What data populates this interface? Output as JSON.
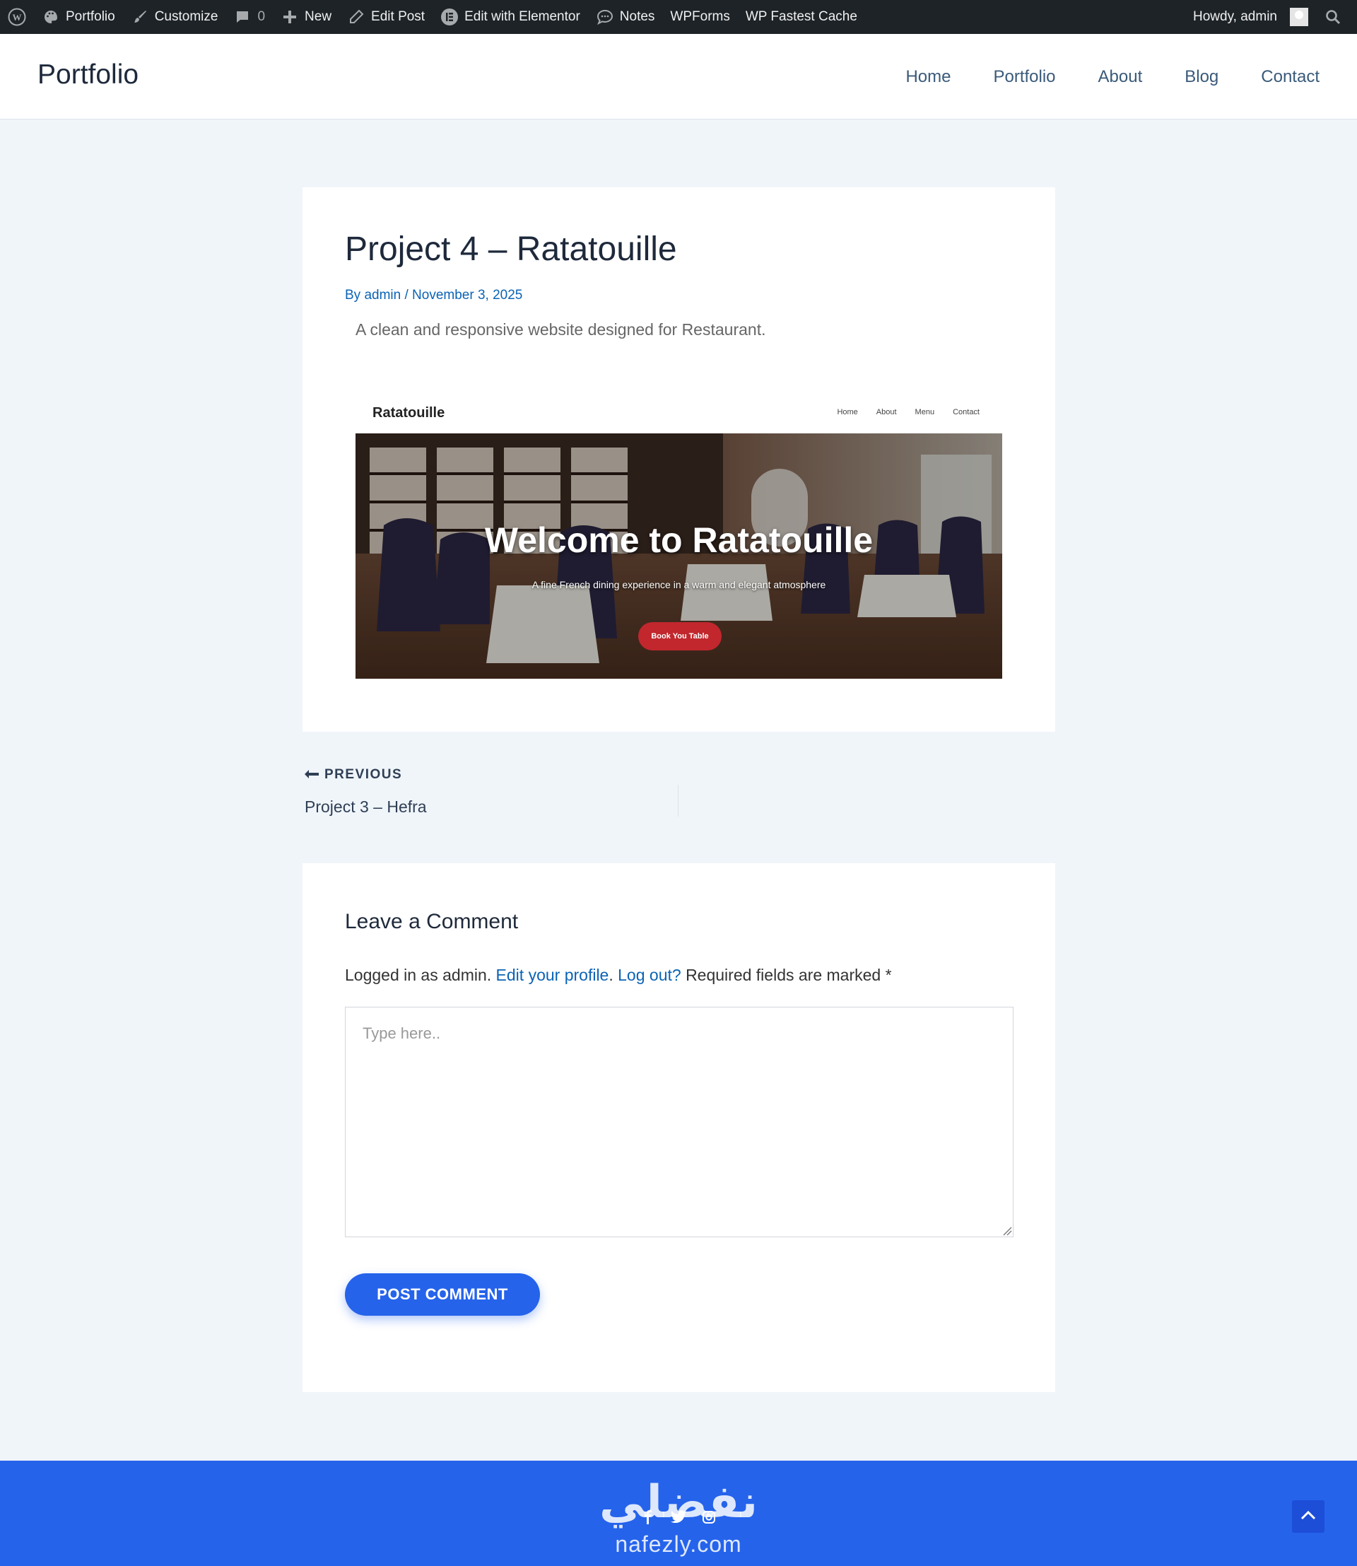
{
  "admin_bar": {
    "items": [
      {
        "label": "Portfolio",
        "icon": "palette-icon"
      },
      {
        "label": "Customize",
        "icon": "brush-icon"
      },
      {
        "label": "0",
        "icon": "comment-icon"
      },
      {
        "label": "New",
        "icon": "plus-icon"
      },
      {
        "label": "Edit Post",
        "icon": "pencil-icon"
      },
      {
        "label": "Edit with Elementor",
        "icon": "elementor-icon"
      },
      {
        "label": "Notes",
        "icon": "notes-icon"
      },
      {
        "label": "WPForms",
        "icon": ""
      },
      {
        "label": "WP Fastest Cache",
        "icon": ""
      }
    ],
    "greeting": "Howdy, admin"
  },
  "header": {
    "site_title": "Portfolio",
    "nav": [
      "Home",
      "Portfolio",
      "About",
      "Blog",
      "Contact"
    ]
  },
  "post": {
    "title": "Project 4 – Ratatouille",
    "meta_by": "By ",
    "author": "admin",
    "meta_sep": " / ",
    "date": "November 3, 2025",
    "description": "A clean and responsive website designed for Restaurant."
  },
  "preview": {
    "logo": "Ratatouille",
    "nav": [
      "Home",
      "About",
      "Menu",
      "Contact"
    ],
    "hero_title": "Welcome to Ratatouille",
    "hero_sub": "A fine French dining experience in a warm and elegant atmosphere",
    "cta": "Book You Table"
  },
  "post_nav": {
    "prev_label": "PREVIOUS",
    "prev_title": "Project 3 – Hefra"
  },
  "comment": {
    "heading": "Leave a Comment",
    "logged_in_text": "Logged in as admin.",
    "edit_profile": "Edit your profile",
    "log_out": "Log out?",
    "required_text": "Required fields are marked",
    "required_star": "*",
    "placeholder": "Type here..",
    "submit": "POST COMMENT"
  },
  "footer": {
    "watermark_ar": "نفضلي",
    "watermark_lat": "nafezly.com"
  },
  "colors": {
    "accent": "#2563eb",
    "admin_bar": "#1d2327",
    "link": "#0b63b5",
    "cta_red": "#c1272d"
  }
}
